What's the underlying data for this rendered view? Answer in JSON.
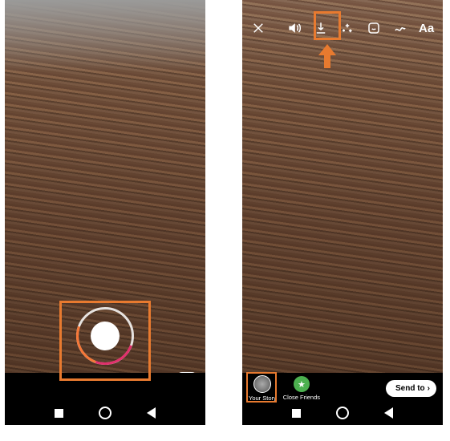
{
  "left_phone": {
    "camera_flip_icon": "camera-reverse"
  },
  "right_phone": {
    "toolbar": {
      "close": "✕",
      "sound": "speaker",
      "download": "download",
      "effects": "sparkle",
      "sticker": "sticker",
      "draw": "scribble",
      "text_label": "Aa"
    },
    "share": {
      "your_story_label": "Your Story",
      "close_friends_label": "Close Friends",
      "send_to_label": "Send to",
      "chevron": "›"
    }
  },
  "annotation": {
    "highlight_color": "#e87a2f"
  }
}
